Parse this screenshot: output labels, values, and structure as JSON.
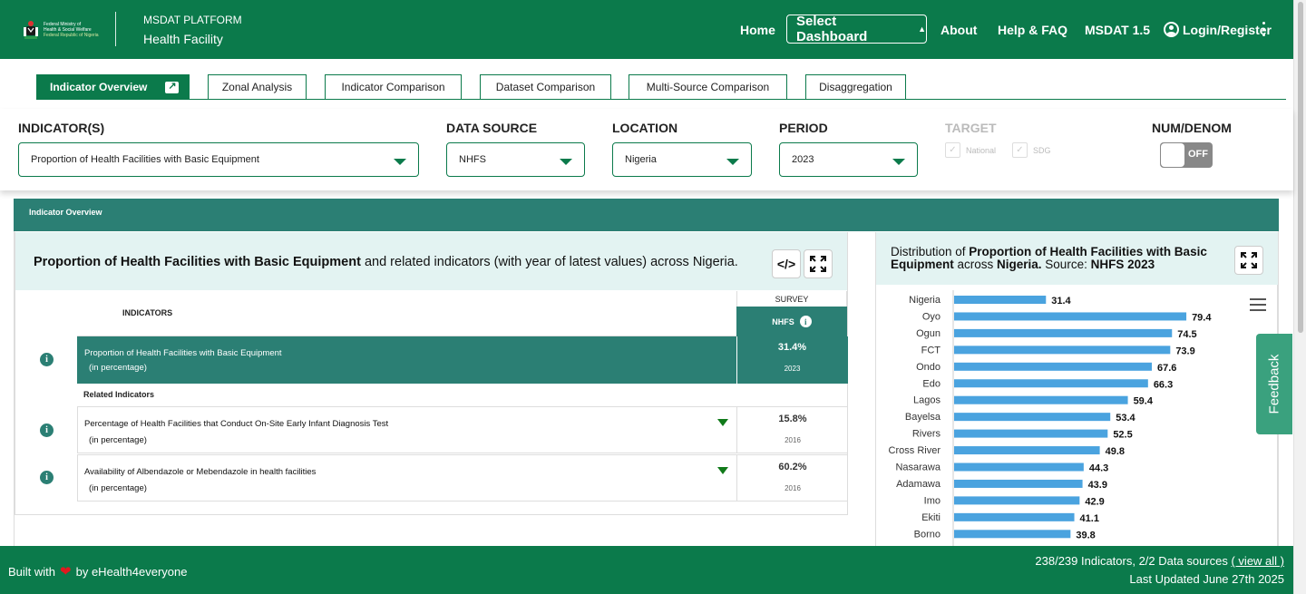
{
  "header": {
    "logo_text": [
      "Federal Ministry of",
      "Health & Social Welfare",
      "Federal Republic of Nigeria"
    ],
    "platform": "MSDAT PLATFORM",
    "subtitle": "Health Facility",
    "nav": {
      "home": "Home",
      "select_dashboard": "Select Dashboard",
      "about": "About",
      "help": "Help & FAQ",
      "msdat": "MSDAT 1.5",
      "login": "Login/Register"
    }
  },
  "tabs": [
    {
      "label": "Indicator Overview",
      "active": true
    },
    {
      "label": "Zonal Analysis"
    },
    {
      "label": "Indicator Comparison"
    },
    {
      "label": "Dataset Comparison"
    },
    {
      "label": "Multi-Source Comparison"
    },
    {
      "label": "Disaggregation"
    }
  ],
  "filters": {
    "indicator_label": "INDICATOR(S)",
    "indicator_value": "Proportion of Health Facilities with Basic Equipment",
    "source_label": "DATA SOURCE",
    "source_value": "NHFS",
    "location_label": "LOCATION",
    "location_value": "Nigeria",
    "period_label": "PERIOD",
    "period_value": "2023",
    "target_label": "TARGET",
    "target_national": "National",
    "target_sdg": "SDG",
    "numdenom_label": "NUM/DENOM",
    "toggle_state": "OFF"
  },
  "overview_bar": "Indicator Overview",
  "left_panel": {
    "title_bold": "Proportion of Health Facilities with Basic Equipment",
    "title_rest": " and related indicators (with year of latest values) across Nigeria.",
    "col_indicators": "INDICATORS",
    "col_survey": "SURVEY",
    "col_source": "NHFS",
    "main_row": {
      "label": "Proportion of Health Facilities with Basic Equipment",
      "unit": "(in percentage)",
      "value": "31.4%",
      "year": "2023"
    },
    "related_label": "Related Indicators",
    "related": [
      {
        "label": "Percentage of Health Facilities that Conduct On-Site Early Infant Diagnosis Test",
        "unit": "(in percentage)",
        "value": "15.8%",
        "year": "2016"
      },
      {
        "label": "Availability of Albendazole or Mebendazole in health facilities",
        "unit": "(in percentage)",
        "value": "60.2%",
        "year": "2016"
      }
    ]
  },
  "right_panel": {
    "title_pre": "Distribution of ",
    "title_bold": "Proportion of Health Facilities with Basic Equipment",
    "title_mid": " across ",
    "title_loc": "Nigeria.",
    "title_src": " Source: ",
    "title_srcb": "NHFS 2023"
  },
  "chart_data": {
    "type": "bar",
    "orientation": "horizontal",
    "categories": [
      "Nigeria",
      "Oyo",
      "Ogun",
      "FCT",
      "Ondo",
      "Edo",
      "Lagos",
      "Bayelsa",
      "Rivers",
      "Cross River",
      "Nasarawa",
      "Adamawa",
      "Imo",
      "Ekiti",
      "Borno"
    ],
    "values": [
      31.4,
      79.4,
      74.5,
      73.9,
      67.6,
      66.3,
      59.4,
      53.4,
      52.5,
      49.8,
      44.3,
      43.9,
      42.9,
      41.1,
      39.8
    ],
    "color": "#4aa3df",
    "xlim": [
      0,
      100
    ]
  },
  "feedback": "Feedback",
  "footer": {
    "built_pre": "Built with",
    "built_post": "by eHealth4everyone",
    "stats": "238/239  Indicators, 2/2  Data sources",
    "view_all": "( view all )",
    "updated": "Last Updated June 27th 2025"
  },
  "colors": {
    "primary": "#0b7a4b",
    "teal": "#2b7f74",
    "light": "#e3f3f2",
    "bar": "#4aa3df"
  }
}
